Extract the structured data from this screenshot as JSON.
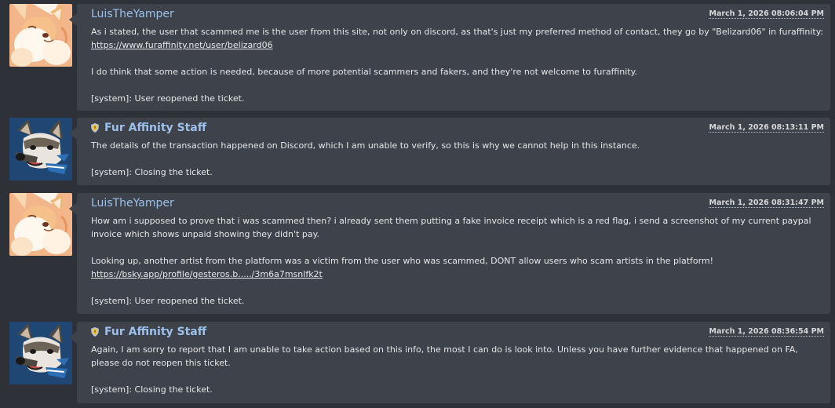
{
  "thread": {
    "posts": [
      {
        "username": "LuisTheYamper",
        "timestamp": "March 1, 2026 08:06:04 PM",
        "line1": "As i stated, the user that scammed me is the user from this site, not only on discord, as that's just my preferred method of contact, they go by \"Belizard06\" in furaffinity:",
        "link1": "https://www.furaffinity.net/user/belizard06",
        "line2": "I do think that some action is needed, because of more potential scammers and fakers, and they're not welcome to furaffinity.",
        "system": "[system]: User reopened the ticket."
      },
      {
        "username": "Fur Affinity Staff",
        "timestamp": "March 1, 2026 08:13:11 PM",
        "line1": "The details of the transaction happened on Discord, which I am unable to verify, so this is why we cannot help in this instance.",
        "system": "[system]: Closing the ticket."
      },
      {
        "username": "LuisTheYamper",
        "timestamp": "March 1, 2026 08:31:47 PM",
        "line1": "How am i supposed to prove that i was scammed then? i already sent them putting a fake invoice receipt which is a red flag, i send a screenshot of my current paypal invoice which shows unpaid showing they didn't pay.",
        "line2": "Looking up, another artist from the platform was a victim from the user who was scammed, DONT allow users who scam artists in the platform!",
        "link1": "https://bsky.app/profile/gesteros.b...../3m6a7msnlfk2t",
        "system": "[system]: User reopened the ticket."
      },
      {
        "username": "Fur Affinity Staff",
        "timestamp": "March 1, 2026 08:36:54 PM",
        "line1": "Again, I am sorry to report that I am unable to take action based on this info, the most I can do is look into. Unless you have further evidence that happened on FA, please do not reopen this ticket.",
        "system": "[system]: Closing the ticket."
      }
    ]
  },
  "icons": {
    "user_avatar": "fox-avatar-icon",
    "staff_avatar": "husky-avatar-icon",
    "staff_badge": "shield-badge-icon"
  },
  "colors": {
    "page_bg": "#2e3138",
    "bubble_bg": "#3e424b",
    "username": "#9cc0ea",
    "text": "#e6e6e6"
  }
}
